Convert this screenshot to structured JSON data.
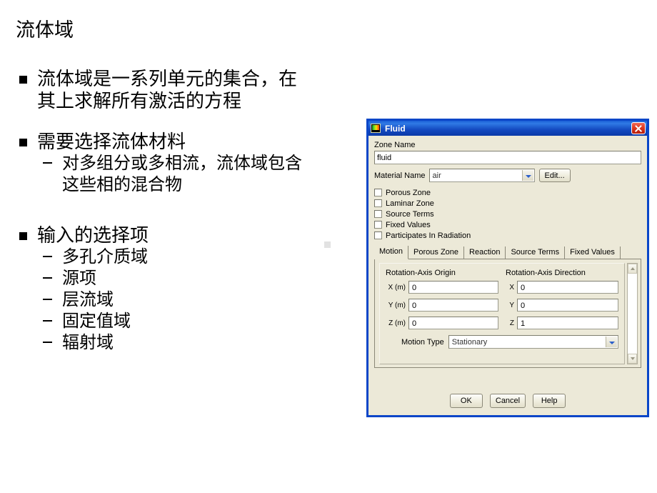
{
  "slide": {
    "title": "流体域",
    "bullets": [
      {
        "level": 1,
        "lines": [
          "流体域是一系列单元的集合，在",
          "其上求解所有激活的方程"
        ]
      },
      {
        "level": 1,
        "lines": [
          "需要选择流体材料"
        ]
      },
      {
        "level": 2,
        "lines": [
          "对多组分或多相流，流体域包含",
          "这些相的混合物"
        ]
      },
      {
        "level": 1,
        "lines": [
          "输入的选择项"
        ]
      },
      {
        "level": 2,
        "lines": [
          "多孔介质域"
        ]
      },
      {
        "level": 2,
        "lines": [
          "源项"
        ]
      },
      {
        "level": 2,
        "lines": [
          "层流域"
        ]
      },
      {
        "level": 2,
        "lines": [
          "固定值域"
        ]
      },
      {
        "level": 2,
        "lines": [
          "辐射域"
        ]
      }
    ]
  },
  "dialog": {
    "title": "Fluid",
    "icon": "fluent-contour-icon",
    "close_label": "×",
    "zone_name": {
      "label": "Zone Name",
      "value": "fluid"
    },
    "material_name": {
      "label": "Material Name",
      "value": "air",
      "edit_label": "Edit..."
    },
    "checkboxes": [
      {
        "label": "Porous Zone",
        "checked": false
      },
      {
        "label": "Laminar Zone",
        "checked": false
      },
      {
        "label": "Source Terms",
        "checked": false
      },
      {
        "label": "Fixed Values",
        "checked": false
      },
      {
        "label": "Participates In Radiation",
        "checked": false
      }
    ],
    "tabs": [
      {
        "label": "Motion",
        "active": true
      },
      {
        "label": "Porous Zone",
        "active": false
      },
      {
        "label": "Reaction",
        "active": false
      },
      {
        "label": "Source Terms",
        "active": false
      },
      {
        "label": "Fixed Values",
        "active": false
      }
    ],
    "motion_tab": {
      "origin": {
        "title": "Rotation-Axis Origin",
        "fields": [
          {
            "label": "X (m)",
            "value": "0"
          },
          {
            "label": "Y (m)",
            "value": "0"
          },
          {
            "label": "Z (m)",
            "value": "0"
          }
        ]
      },
      "direction": {
        "title": "Rotation-Axis Direction",
        "fields": [
          {
            "label": "X",
            "value": "0"
          },
          {
            "label": "Y",
            "value": "0"
          },
          {
            "label": "Z",
            "value": "1"
          }
        ]
      },
      "motion_type": {
        "label": "Motion Type",
        "value": "Stationary"
      }
    },
    "buttons": [
      {
        "label": "OK"
      },
      {
        "label": "Cancel"
      },
      {
        "label": "Help"
      }
    ]
  },
  "colors": {
    "titlebar_blue": "#1b5fd6",
    "dialog_face": "#ece9d8",
    "dialog_border": "#0a46c8",
    "close_red": "#e03a21"
  }
}
